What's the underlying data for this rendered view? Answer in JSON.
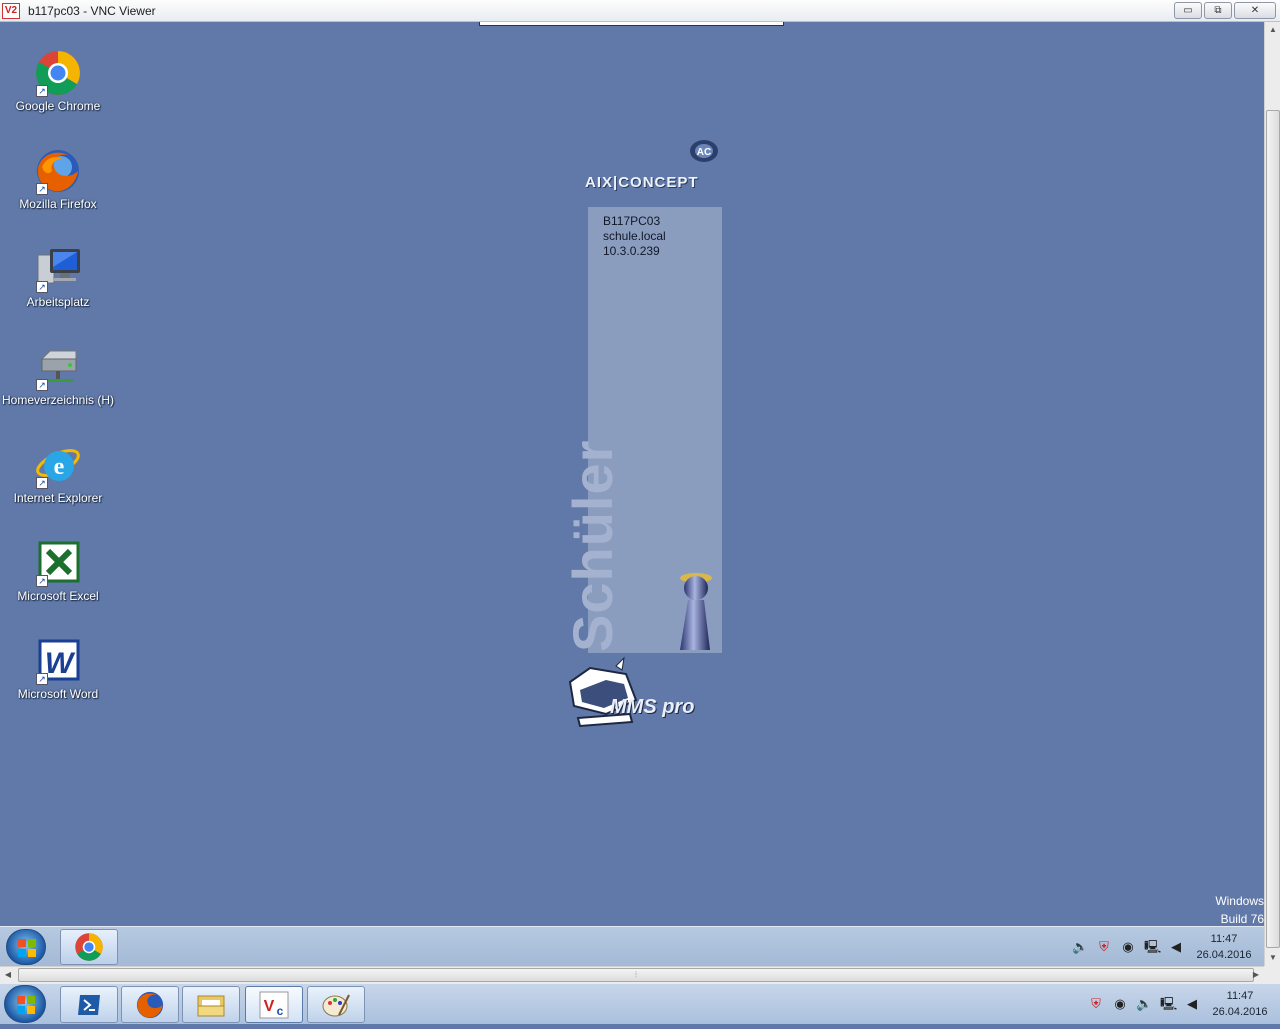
{
  "window": {
    "title": "b117pc03 - VNC Viewer",
    "logo": "V2",
    "minimize": "▭",
    "restore": "⧉",
    "close": "✕"
  },
  "desktop_icons": [
    {
      "label": "Google Chrome",
      "icon": "chrome-icon"
    },
    {
      "label": "Mozilla Firefox",
      "icon": "firefox-icon"
    },
    {
      "label": "Arbeitsplatz",
      "icon": "computer-icon"
    },
    {
      "label": "Homeverzeichnis (H)",
      "icon": "network-drive-icon"
    },
    {
      "label": "Internet Explorer",
      "icon": "internet-explorer-icon"
    },
    {
      "label": "Microsoft Excel",
      "icon": "excel-icon"
    },
    {
      "label": "Microsoft Word",
      "icon": "word-icon"
    }
  ],
  "login_panel": {
    "brand_logo_text": "AIX|CONCEPT",
    "hostname": "B117PC03",
    "domain": "schule.local",
    "ip": "10.3.0.239",
    "role_label": "Schüler",
    "product_logo_text": "MMS pro"
  },
  "watermark": {
    "line1": "Windows",
    "line2": "Build 76"
  },
  "remote_taskbar": {
    "clock_time": "11:47",
    "clock_date": "26.04.2016"
  },
  "host_taskbar": {
    "clock_time": "11:47",
    "clock_date": "26.04.2016",
    "tray_glyphs": {
      "speaker": "🔈",
      "shield": "⛨",
      "media": "◉",
      "network": "🖳",
      "volume": "◀"
    }
  },
  "colors": {
    "desktop": "#6079a8",
    "panel": "#8b9dbf"
  }
}
